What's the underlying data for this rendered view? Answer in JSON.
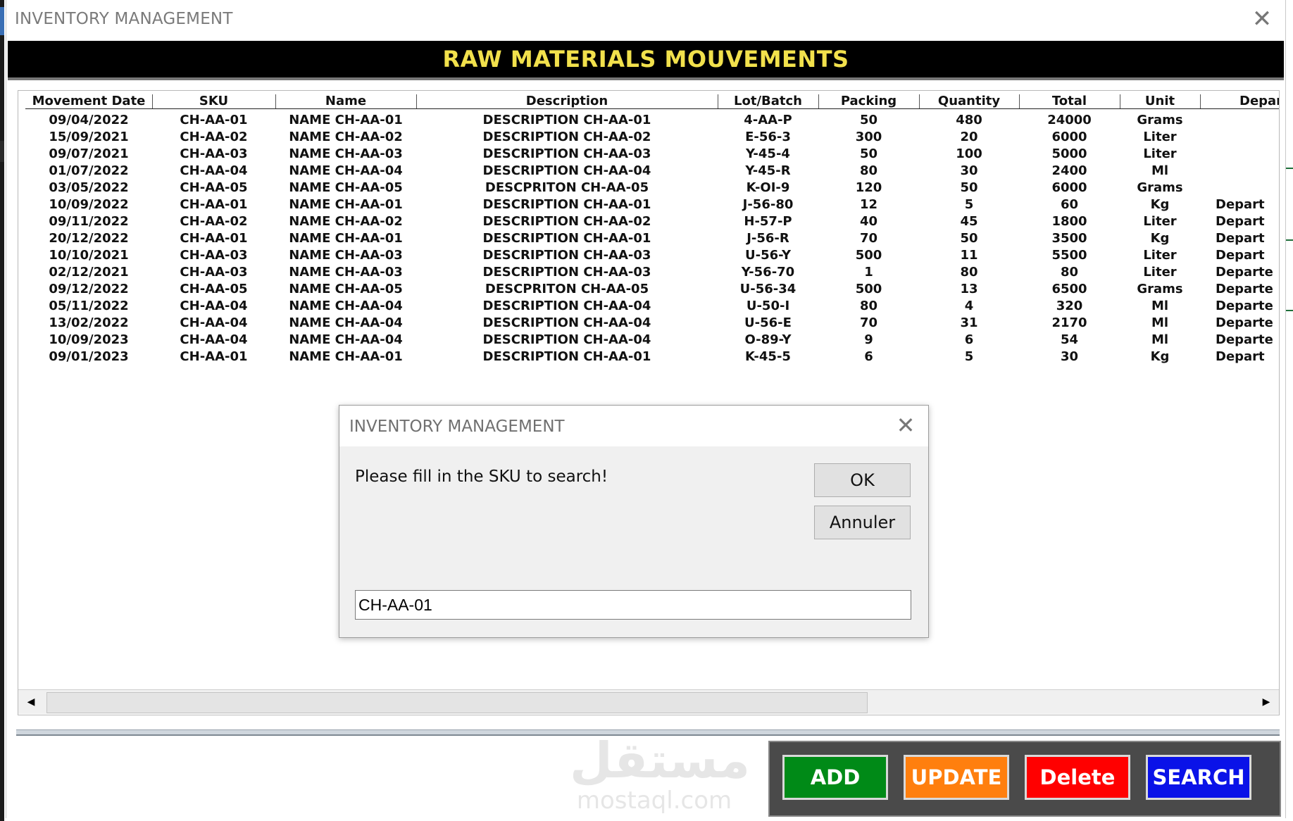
{
  "window": {
    "title": "INVENTORY MANAGEMENT"
  },
  "banner": {
    "title": "RAW MATERIALS MOUVEMENTS"
  },
  "table": {
    "headers": [
      "Movement Date",
      "SKU",
      "Name",
      "Description",
      "Lot/Batch",
      "Packing",
      "Quantity",
      "Total",
      "Unit",
      "Depar"
    ],
    "rows": [
      [
        "09/04/2022",
        "CH-AA-01",
        "NAME CH-AA-01",
        "DESCRIPTION CH-AA-01",
        "4-AA-P",
        "50",
        "480",
        "24000",
        "Grams",
        ""
      ],
      [
        "15/09/2021",
        "CH-AA-02",
        "NAME CH-AA-02",
        "DESCRIPTION CH-AA-02",
        "E-56-3",
        "300",
        "20",
        "6000",
        "Liter",
        ""
      ],
      [
        "09/07/2021",
        "CH-AA-03",
        "NAME CH-AA-03",
        "DESCRIPTION CH-AA-03",
        "Y-45-4",
        "50",
        "100",
        "5000",
        "Liter",
        ""
      ],
      [
        "01/07/2022",
        "CH-AA-04",
        "NAME CH-AA-04",
        "DESCRIPTION CH-AA-04",
        "Y-45-R",
        "80",
        "30",
        "2400",
        "Ml",
        ""
      ],
      [
        "03/05/2022",
        "CH-AA-05",
        "NAME CH-AA-05",
        "DESCPRITON CH-AA-05",
        "K-OI-9",
        "120",
        "50",
        "6000",
        "Grams",
        ""
      ],
      [
        "10/09/2022",
        "CH-AA-01",
        "NAME CH-AA-01",
        "DESCRIPTION CH-AA-01",
        "J-56-80",
        "12",
        "5",
        "60",
        "Kg",
        "Depart"
      ],
      [
        "09/11/2022",
        "CH-AA-02",
        "NAME CH-AA-02",
        "DESCRIPTION CH-AA-02",
        "H-57-P",
        "40",
        "45",
        "1800",
        "Liter",
        "Depart"
      ],
      [
        "20/12/2022",
        "CH-AA-01",
        "NAME CH-AA-01",
        "DESCRIPTION CH-AA-01",
        "J-56-R",
        "70",
        "50",
        "3500",
        "Kg",
        "Depart"
      ],
      [
        "10/10/2021",
        "CH-AA-03",
        "NAME CH-AA-03",
        "DESCRIPTION CH-AA-03",
        "U-56-Y",
        "500",
        "11",
        "5500",
        "Liter",
        "Depart"
      ],
      [
        "02/12/2021",
        "CH-AA-03",
        "NAME CH-AA-03",
        "DESCRIPTION CH-AA-03",
        "Y-56-70",
        "1",
        "80",
        "80",
        "Liter",
        "Departe"
      ],
      [
        "09/12/2022",
        "CH-AA-05",
        "NAME CH-AA-05",
        "DESCPRITON CH-AA-05",
        "U-56-34",
        "500",
        "13",
        "6500",
        "Grams",
        "Departe"
      ],
      [
        "05/11/2022",
        "CH-AA-04",
        "NAME CH-AA-04",
        "DESCRIPTION CH-AA-04",
        "U-50-I",
        "80",
        "4",
        "320",
        "Ml",
        "Departe"
      ],
      [
        "13/02/2022",
        "CH-AA-04",
        "NAME CH-AA-04",
        "DESCRIPTION CH-AA-04",
        "U-56-E",
        "70",
        "31",
        "2170",
        "Ml",
        "Departe"
      ],
      [
        "10/09/2023",
        "CH-AA-04",
        "NAME CH-AA-04",
        "DESCRIPTION CH-AA-04",
        "O-89-Y",
        "9",
        "6",
        "54",
        "Ml",
        "Departe"
      ],
      [
        "09/01/2023",
        "CH-AA-01",
        "NAME CH-AA-01",
        "DESCRIPTION CH-AA-01",
        "K-45-5",
        "6",
        "5",
        "30",
        "Kg",
        "Depart"
      ]
    ]
  },
  "scrollbar": {
    "left_arrow": "◀",
    "right_arrow": "▶"
  },
  "buttons": [
    {
      "label": "ADD",
      "color": "#008a17"
    },
    {
      "label": "UPDATE",
      "color": "#ff7f0e"
    },
    {
      "label": "Delete",
      "color": "#ff0000"
    },
    {
      "label": "SEARCH",
      "color": "#0a12e8"
    }
  ],
  "watermark": {
    "arabic": "مستقل",
    "latin": "mostaql.com"
  },
  "dialog": {
    "title": "INVENTORY MANAGEMENT",
    "close_glyph": "✕",
    "message": "Please fill in the SKU to search!",
    "ok_label": "OK",
    "cancel_label": "Annuler",
    "input_value": "CH-AA-01"
  },
  "icons": {
    "window_close": "close-icon",
    "dialog_close": "close-icon"
  }
}
